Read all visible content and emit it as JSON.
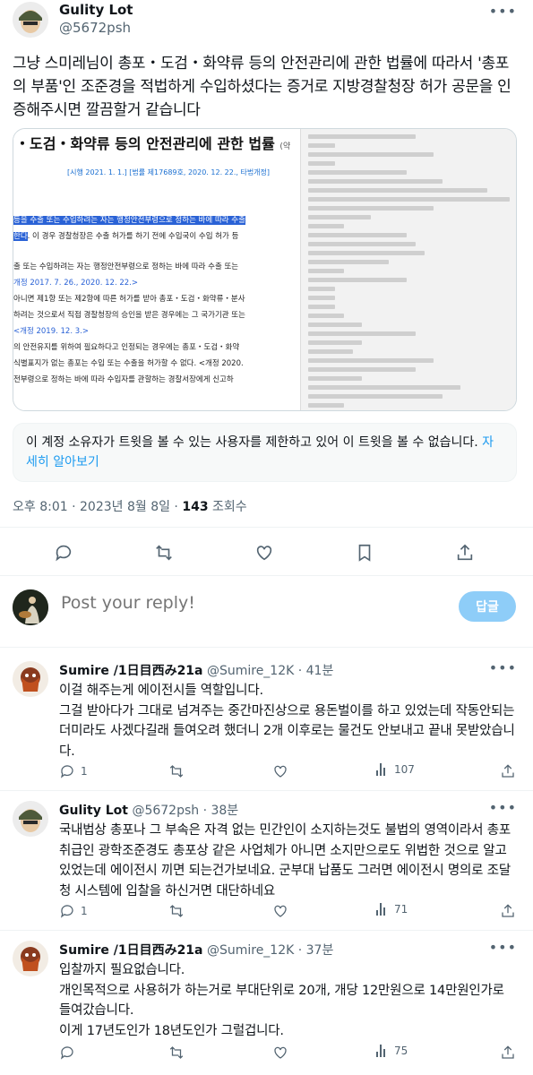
{
  "tweet": {
    "name": "Gulity Lot",
    "handle": "@5672psh",
    "text": "그냥 스미레님이 총포・도검・화약류 등의 안전관리에 관한 법률에 따라서 '총포의 부품'인 조준경을 적법하게 수입하셨다는 증거로 지방경찰청장 허가 공문을 인증해주시면 깔끔할거 같습니다",
    "media": {
      "doc_title": "・도검・화약류 등의 안전관리에 관한 법률",
      "doc_title_suffix": "(약",
      "doc_subtitle": "[시행 2021. 1. 1.] [법률 제17689호, 2020. 12. 22., 타법개정]",
      "doc_line_1_hl": "등을 수출 또는 수입하려는 자는 행정안전부령으로 정하는 바에 따라 수출",
      "doc_line_2_hl": "한다",
      "doc_line_2": ". 이 경우 경찰청장은 수출 허가를 하기 전에 수입국이 수입 허가 등",
      "doc_line_3": "출 또는 수입하려는 자는 행정안전부령으로 정하는 바에 따라 수출 또는",
      "doc_line_4": "개정 2017. 7. 26., 2020. 12. 22.>",
      "doc_line_5": "아니면 제1항 또는 제2항에 따른 허가를 받아 총포・도검・화약류・분사",
      "doc_line_6": "하려는 것으로서 직접 경찰청장의 승인을 받은 경우에는 그 국가기관 또는",
      "doc_line_7": "<개정 2019. 12. 3.>",
      "doc_line_8": "의 안전유지를 위하여 필요하다고 인정되는 경우에는 총포・도검・화약",
      "doc_line_9": "식별표지가 없는 총포는 수입 또는 수출을 허가할 수 없다. <개정 2020.",
      "doc_line_10": "전부령으로 정하는 바에 따라 수입자를 관할하는 경찰서장에게 신고하"
    },
    "notice_text": "이 계정 소유자가 트윗을 볼 수 있는 사용자를 제한하고 있어 이 트윗을 볼 수 없습니다.",
    "notice_link": "자세히 알아보기",
    "time": "오후 8:01 · 2023년 8월 8일 · ",
    "views_count": "143",
    "views_label": " 조회수"
  },
  "composer": {
    "placeholder": "Post your reply!",
    "button": "답글"
  },
  "replies": [
    {
      "name": "Sumire /1日目西み21a",
      "handle": "@Sumire_12K",
      "time": "· 41분",
      "text": "이걸 해주는게 에이전시들 역할입니다.\n그걸 받아다가 그대로 넘겨주는 중간마진상으로 용돈벌이를 하고 있었는데 작동안되는 더미라도 사겠다길래 들여오려 했더니 2개 이후로는 물건도 안보내고 끝내 못받았습니다.",
      "replies_count": "1",
      "retweets": "",
      "likes": "",
      "views": "107"
    },
    {
      "name": "Gulity Lot",
      "handle": "@5672psh",
      "time": "· 38분",
      "text": "국내법상 총포나 그 부속은 자격 없는 민간인이 소지하는것도 불법의 영역이라서 총포 취급인 광학조준경도 총포상 같은 사업체가 아니면 소지만으로도 위법한 것으로 알고 있었는데 에이전시 끼면 되는건가보네요. 군부대 납품도 그러면 에이전시 명의로 조달청 시스템에 입찰을 하신거면 대단하네요",
      "replies_count": "1",
      "retweets": "",
      "likes": "",
      "views": "71"
    },
    {
      "name": "Sumire /1日目西み21a",
      "handle": "@Sumire_12K",
      "time": "· 37분",
      "text": "입찰까지 필요없습니다.\n개인목적으로 사용허가 하는거로 부대단위로 20개, 개당 12만원으로 14만원인가로 들여갔습니다.\n이게 17년도인가 18년도인가 그럴겁니다.",
      "replies_count": "",
      "retweets": "",
      "likes": "",
      "views": "75"
    }
  ]
}
